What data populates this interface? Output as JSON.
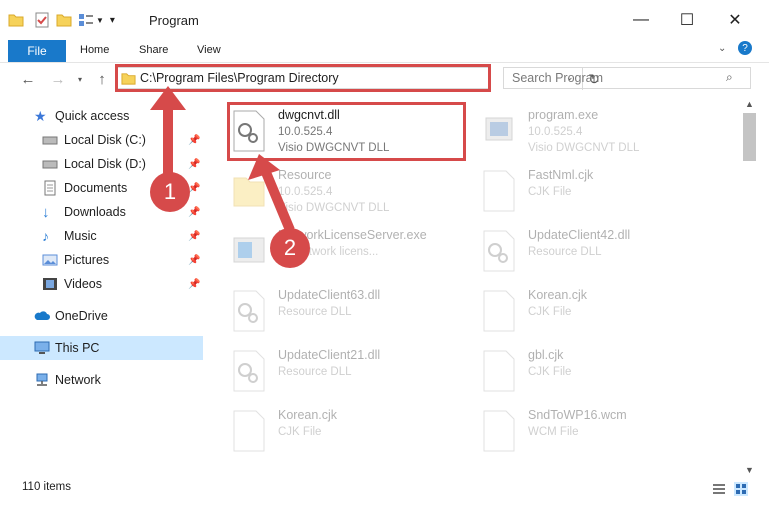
{
  "window": {
    "title": "Program"
  },
  "ribbon": {
    "tabs": [
      "File",
      "Home",
      "Share",
      "View"
    ]
  },
  "address": {
    "path": "C:\\Program Files\\Program Directory"
  },
  "search": {
    "placeholder": "Search Program"
  },
  "sidebar": {
    "items": [
      {
        "label": "Quick access",
        "icon": "star-icon"
      },
      {
        "label": "Local Disk (C:)",
        "icon": "drive-icon"
      },
      {
        "label": "Local Disk (D:)",
        "icon": "drive-icon"
      },
      {
        "label": "Documents",
        "icon": "documents-icon"
      },
      {
        "label": "Downloads",
        "icon": "download-icon"
      },
      {
        "label": "Music",
        "icon": "music-icon"
      },
      {
        "label": "Pictures",
        "icon": "pictures-icon"
      },
      {
        "label": "Videos",
        "icon": "videos-icon"
      },
      {
        "label": "OneDrive",
        "icon": "cloud-icon"
      },
      {
        "label": "This PC",
        "icon": "computer-icon"
      },
      {
        "label": "Network",
        "icon": "network-icon"
      }
    ]
  },
  "files": [
    {
      "name": "dwgcnvt.dll",
      "line1": "10.0.525.4",
      "line2": "Visio DWGCNVT DLL"
    },
    {
      "name": "program.exe",
      "line1": "10.0.525.4",
      "line2": "Visio DWGCNVT DLL"
    },
    {
      "name": "Resource",
      "line1": "10.0.525.4",
      "line2": "Visio DWGCNVT DLL"
    },
    {
      "name": "FastNml.cjk",
      "line1": "CJK File",
      "line2": ""
    },
    {
      "name": "NetworkLicenseServer.exe",
      "line1": "FV network licens...",
      "line2": ""
    },
    {
      "name": "UpdateClient42.dll",
      "line1": "Resource DLL",
      "line2": ""
    },
    {
      "name": "UpdateClient63.dll",
      "line1": "Resource DLL",
      "line2": ""
    },
    {
      "name": "Korean.cjk",
      "line1": "CJK File",
      "line2": ""
    },
    {
      "name": "UpdateClient21.dll",
      "line1": "Resource DLL",
      "line2": ""
    },
    {
      "name": "gbl.cjk",
      "line1": "CJK File",
      "line2": ""
    },
    {
      "name": "Korean.cjk",
      "line1": "CJK File",
      "line2": ""
    },
    {
      "name": "SndToWP16.wcm",
      "line1": "WCM File",
      "line2": ""
    }
  ],
  "status": {
    "items": "110 items"
  },
  "annotations": {
    "step1": "1",
    "step2": "2"
  },
  "colors": {
    "accent": "#1979ca",
    "highlight": "#d64a4a"
  }
}
